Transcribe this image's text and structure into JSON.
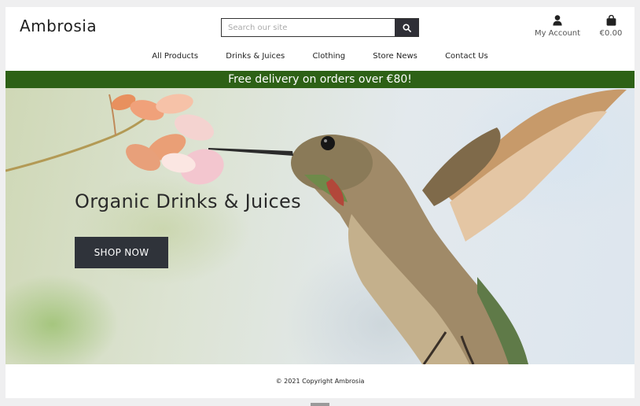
{
  "header": {
    "logo": "Ambrosia",
    "search": {
      "placeholder": "Search our site",
      "value": ""
    },
    "account_label": "My Account",
    "cart_total": "€0.00"
  },
  "nav": {
    "items": [
      {
        "label": "All Products"
      },
      {
        "label": "Drinks & Juices"
      },
      {
        "label": "Clothing"
      },
      {
        "label": "Store News"
      },
      {
        "label": "Contact Us"
      }
    ]
  },
  "banner": {
    "text": "Free delivery on orders over €80!"
  },
  "hero": {
    "title": "Organic Drinks & Juices",
    "cta_label": "SHOP NOW"
  },
  "footer": {
    "copyright": "© 2021 Copyright Ambrosia"
  },
  "icons": {
    "search": "search-icon",
    "account": "user-icon",
    "cart": "shopping-bag-icon"
  },
  "colors": {
    "banner_bg": "#2d6116",
    "button_dark": "#2f333a"
  }
}
